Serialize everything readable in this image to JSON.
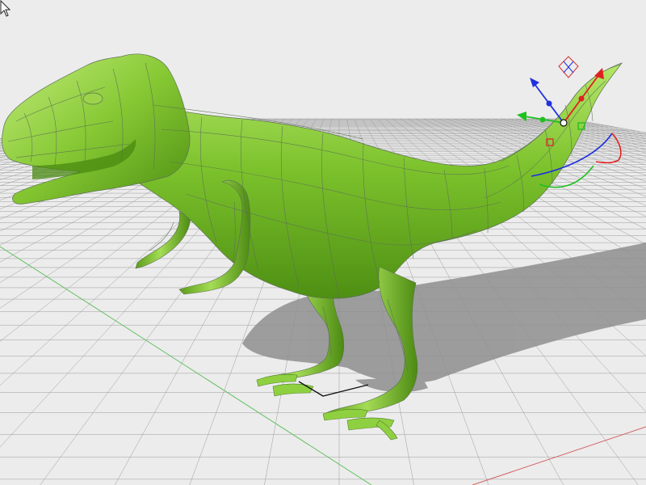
{
  "viewport": {
    "projection": "perspective",
    "background_color": "#ececec",
    "grid_color": "#9b9b9b",
    "x_axis_color": "#d46060",
    "y_axis_color": "#62c062",
    "shadow_color": "#8f8f8f"
  },
  "model": {
    "object": "t-rex-dinosaur",
    "surface_color": "#7cc22c",
    "surface_dark": "#4e8f13",
    "surface_light": "#b6e66a",
    "wireframe_color": "#5d6f55",
    "display": "shaded-with-isocurves"
  },
  "gizmo": {
    "type": "move-rotate-scale-widget",
    "x_color": "#e02020",
    "y_color": "#20c020",
    "z_color": "#2030e0",
    "plane_color": "#d03030"
  },
  "cursor": {
    "icon": "arrow-pointer-icon"
  }
}
